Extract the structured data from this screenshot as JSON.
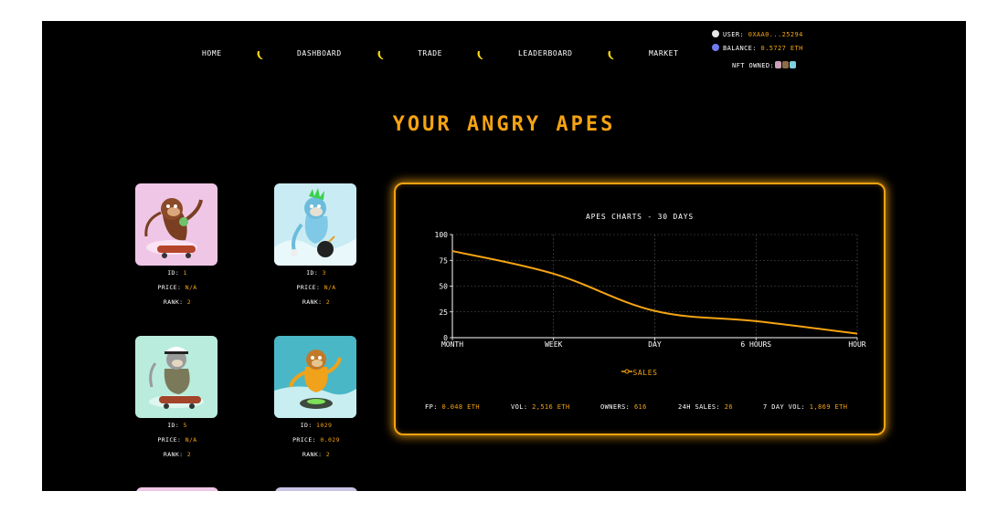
{
  "nav": {
    "items": [
      {
        "label": "HOME"
      },
      {
        "label": "DASHBOARD"
      },
      {
        "label": "TRADE"
      },
      {
        "label": "LEADERBOARD"
      },
      {
        "label": "MARKET"
      }
    ],
    "separator_icon": "banana-icon"
  },
  "user": {
    "user_label": "USER:",
    "user_value": "0XAA0...25294",
    "balance_label": "BALANCE:",
    "balance_value": "0.5727 ETH",
    "nft_label": "NFT OWNED:"
  },
  "title": "YOUR ANGRY APES",
  "cards": [
    {
      "id_label": "ID:",
      "id": "1",
      "price_label": "PRICE:",
      "price": "N/A",
      "rank_label": "RANK:",
      "rank": "2",
      "bg": "#f0c6e6"
    },
    {
      "id_label": "ID:",
      "id": "3",
      "price_label": "PRICE:",
      "price": "N/A",
      "rank_label": "RANK:",
      "rank": "2",
      "bg": "#c9ecf4"
    },
    {
      "id_label": "ID:",
      "id": "5",
      "price_label": "PRICE:",
      "price": "N/A",
      "rank_label": "RANK:",
      "rank": "2",
      "bg": "#b9ecdc"
    },
    {
      "id_label": "ID:",
      "id": "1029",
      "price_label": "PRICE:",
      "price": "0.029",
      "rank_label": "RANK:",
      "rank": "2",
      "bg": "#4ab7c6"
    }
  ],
  "chart_data": {
    "type": "line",
    "title": "APES CHARTS - 30 DAYS",
    "categories": [
      "MONTH",
      "WEEK",
      "DAY",
      "6 HOURS",
      "HOUR"
    ],
    "series": [
      {
        "name": "SALES",
        "values": [
          84,
          62,
          26,
          16,
          4
        ]
      }
    ],
    "ylim": [
      0,
      100
    ],
    "yticks": [
      0,
      25,
      50,
      75,
      100
    ],
    "grid": true,
    "legend": "bottom-center",
    "color": "#f5a312"
  },
  "stats": [
    {
      "label": "FP:",
      "value": "0.048 ETH"
    },
    {
      "label": "VOL:",
      "value": "2,516 ETH"
    },
    {
      "label": "OWNERS:",
      "value": "616"
    },
    {
      "label": "24H SALES:",
      "value": "26"
    },
    {
      "label": "7 DAY VOL:",
      "value": "1,869 ETH"
    }
  ],
  "colors": {
    "accent": "#f5a312",
    "background": "#000000",
    "text": "#ffffff"
  }
}
